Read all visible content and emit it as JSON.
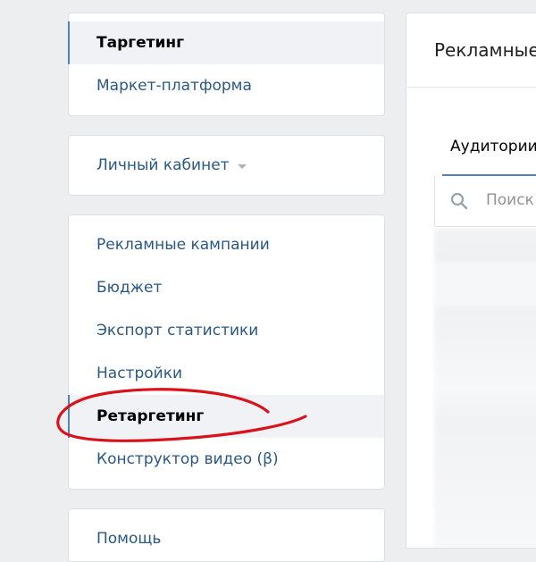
{
  "top_nav": {
    "items": [
      {
        "label": "Таргетинг",
        "active": true
      },
      {
        "label": "Маркет-платформа",
        "active": false
      }
    ]
  },
  "account_switcher": {
    "label": "Личный кабинет"
  },
  "ads_menu": {
    "items": [
      {
        "label": "Рекламные кампании",
        "active": false
      },
      {
        "label": "Бюджет",
        "active": false
      },
      {
        "label": "Экспорт статистики",
        "active": false
      },
      {
        "label": "Настройки",
        "active": false
      },
      {
        "label": "Ретаргетинг",
        "active": true
      },
      {
        "label": "Конструктор видео (β)",
        "active": false
      }
    ]
  },
  "help_menu": {
    "label": "Помощь"
  },
  "content": {
    "title": "Рекламные кабинеты",
    "tab_label": "Аудитории",
    "search_placeholder": "Поиск"
  },
  "colors": {
    "accent": "#5181b8",
    "link": "#2a5885",
    "page_background": "#edeef0",
    "highlight_circle": "#d9121b"
  }
}
